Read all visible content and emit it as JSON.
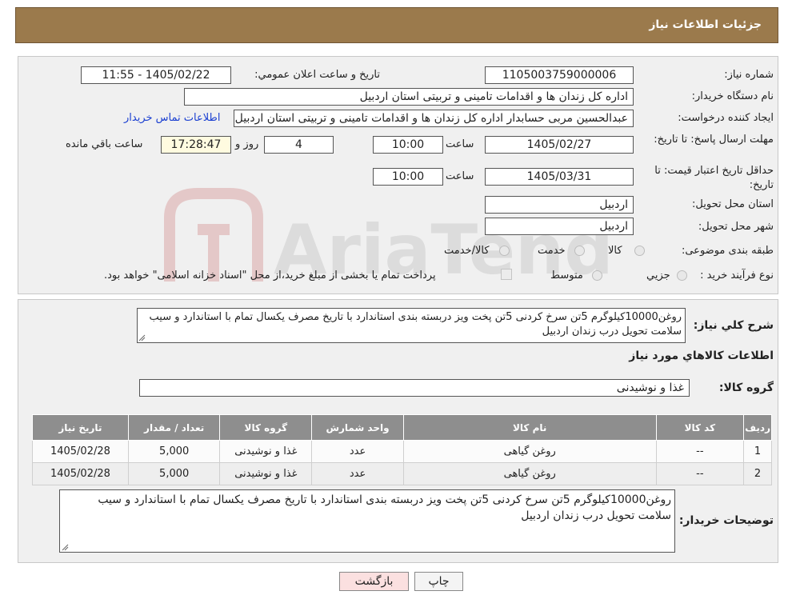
{
  "header": {
    "title": "جزئیات اطلاعات نیاز"
  },
  "watermark": {
    "text": "AriaTender.neT"
  },
  "form": {
    "need_number_label": "شماره نیاز:",
    "need_number": "1105003759000006",
    "announce_label": "تاریخ و ساعت اعلان عمومي:",
    "announce_value": "1405/02/22 - 11:55",
    "buyer_org_label": "نام دستگاه خریدار:",
    "buyer_org": "اداره کل زندان ها و اقدامات تامینی و تربیتی استان اردبیل",
    "creator_label": "ایجاد کننده درخواست:",
    "creator": "عبدالحسین مربی حسابدار اداره کل زندان ها و اقدامات تامینی و تربیتی استان اردبیل",
    "contact_link": "اطلاعات تماس خریدار",
    "deadline_label": "مهلت ارسال پاسخ: تا تاریخ:",
    "deadline_date": "1405/02/27",
    "time_label": "ساعت",
    "deadline_time": "10:00",
    "days_value": "4",
    "days_label": "روز و",
    "remaining_time": "17:28:47",
    "remaining_label": "ساعت باقي مانده",
    "validity_label": "حداقل تاریخ اعتبار قیمت: تا تاریخ:",
    "validity_date": "1405/03/31",
    "validity_time": "10:00",
    "province_label": "استان محل تحویل:",
    "province": "اردبیل",
    "city_label": "شهر محل تحویل:",
    "city": "اردبیل",
    "category_label": "طبقه بندی موضوعی:",
    "category_options": [
      "کالا",
      "خدمت",
      "کالا/خدمت"
    ],
    "purchase_type_label": "نوع فرآیند خرید :",
    "purchase_type_options": [
      "جزيي",
      "متوسط"
    ],
    "payment_note": "پرداخت تمام یا بخشی از مبلغ خرید،از محل \"اسناد خزانه اسلامی\" خواهد بود."
  },
  "summary": {
    "label": "شرح کلي نياز:",
    "text": "روغن10000کیلوگرم 5تن سرخ کردنی 5تن پخت ویز دربسته بندی استاندارد با تاریخ مصرف یکسال تمام با استاندارد و سیب سلامت تحویل درب زندان اردبیل"
  },
  "goods": {
    "section_title": "اطلاعات کالاهاي مورد نياز",
    "group_label": "گروه کالا:",
    "group_value": "غذا و نوشیدنی",
    "columns": [
      "ردیف",
      "کد کالا",
      "نام کالا",
      "واحد شمارش",
      "گروه کالا",
      "تعداد / مقدار",
      "تاریخ نیاز"
    ],
    "rows": [
      [
        "1",
        "--",
        "روغن گیاهی",
        "عدد",
        "غذا و نوشیدنی",
        "5,000",
        "1405/02/28"
      ],
      [
        "2",
        "--",
        "روغن گیاهی",
        "عدد",
        "غذا و نوشیدنی",
        "5,000",
        "1405/02/28"
      ]
    ]
  },
  "buyer_notes": {
    "label": "توضیحات خریدار:",
    "text": "روغن10000کیلوگرم 5تن سرخ کردنی 5تن پخت ویز دربسته بندی استاندارد با تاریخ مصرف یکسال تمام با استاندارد و سیب سلامت تحویل درب زندان اردبیل"
  },
  "buttons": {
    "print": "چاپ",
    "back": "بازگشت"
  },
  "colors": {
    "header": "#9b7a4c",
    "back_button": "#fbe0e0",
    "table_header": "#8e8e8e"
  }
}
